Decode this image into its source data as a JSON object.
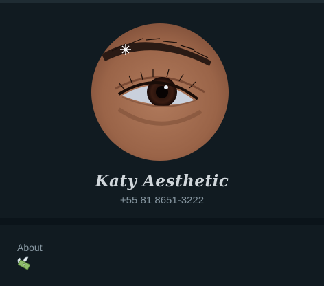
{
  "profile": {
    "name": "Katy Aesthetic",
    "phone": "+55 81 8651-3222"
  },
  "about": {
    "label": "About",
    "emoji": "money-with-wings-icon"
  },
  "colors": {
    "background": "#111b21",
    "divider": "#0b141a",
    "name_text": "#d1d7db",
    "secondary_text": "#8696a0"
  }
}
